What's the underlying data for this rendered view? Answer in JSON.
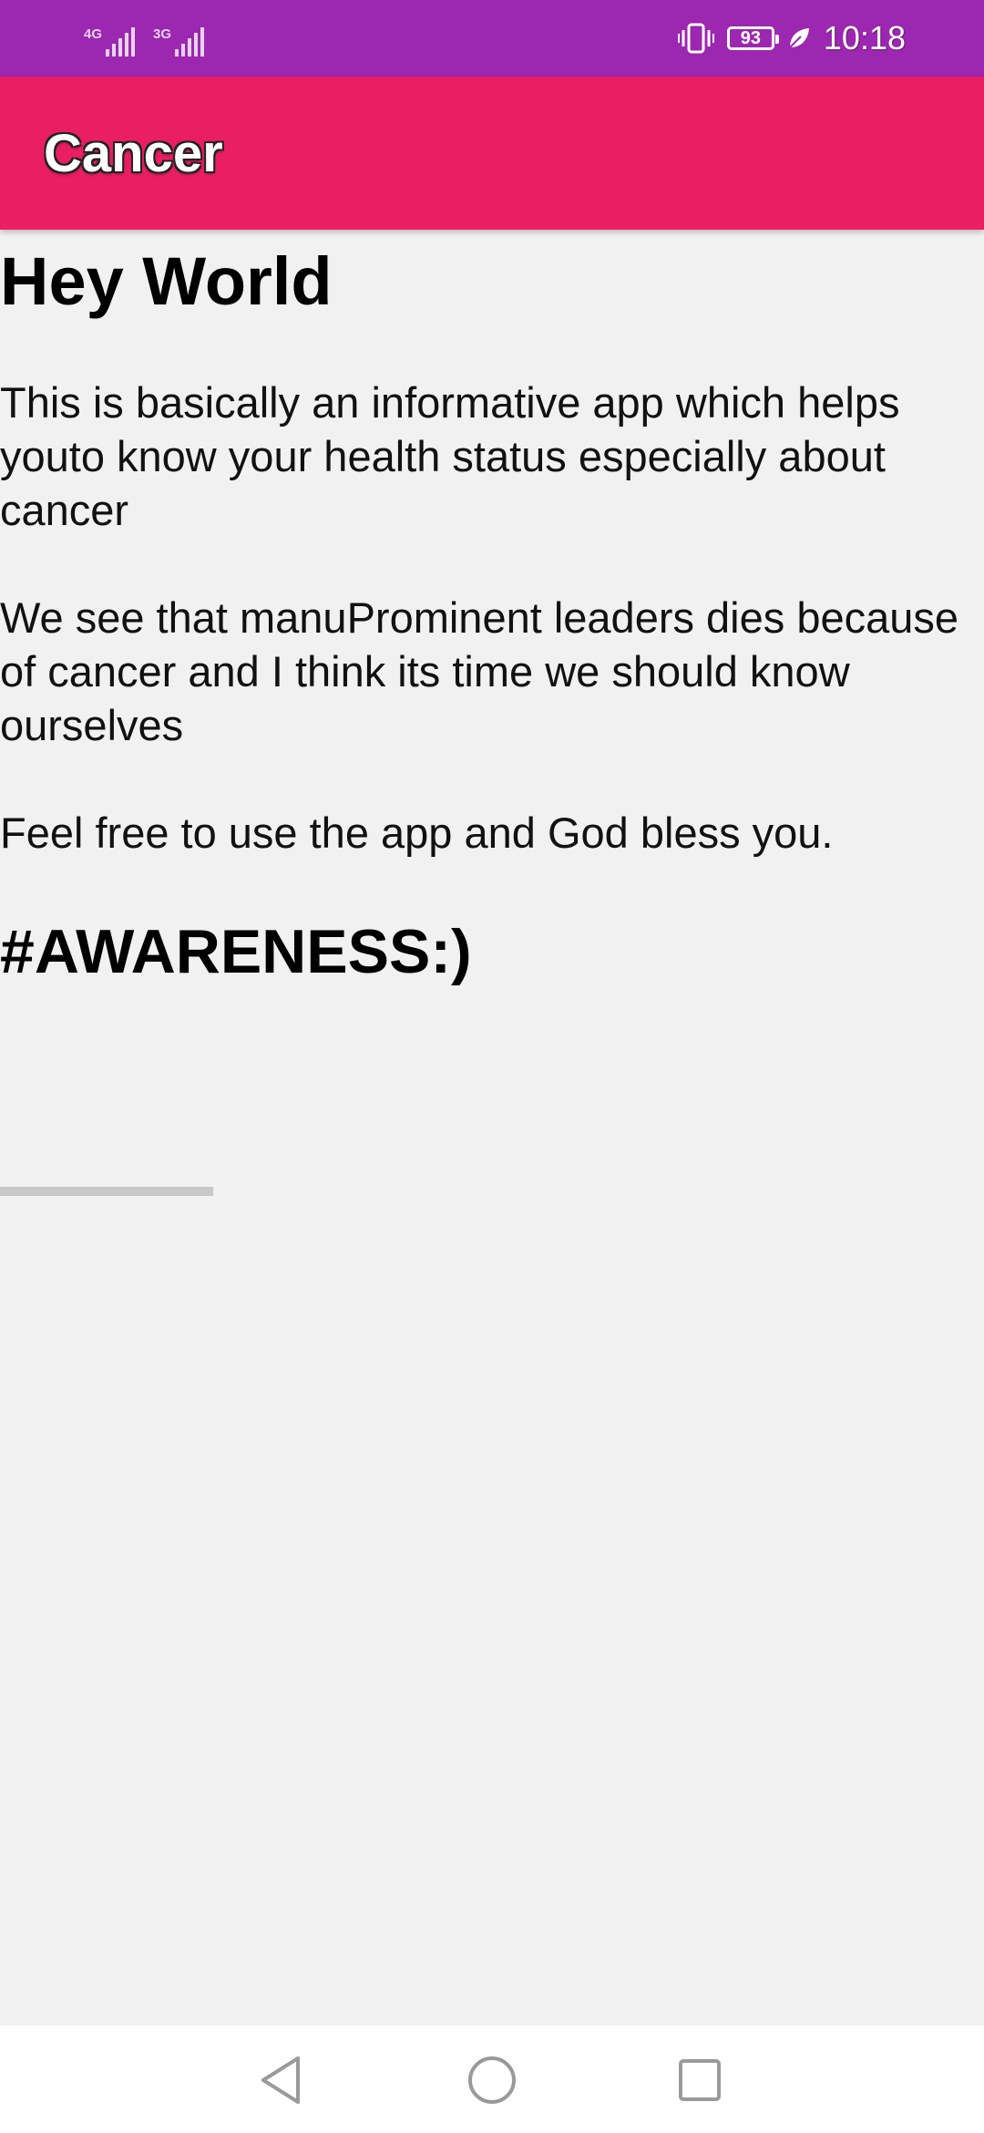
{
  "status_bar": {
    "network_1": "4G",
    "network_2": "3G",
    "battery_level": "93",
    "time": "10:18",
    "icons": [
      "signal-icon",
      "vibrate-icon",
      "battery-icon",
      "power-saver-leaf-icon"
    ]
  },
  "app_bar": {
    "title": "Cancer"
  },
  "content": {
    "heading": "Hey World",
    "paragraphs": [
      "This is basically an informative app which helps youto know your health status especially about cancer",
      "We see that manuProminent leaders dies because of cancer and I think its time we should know ourselves",
      "Feel free to use the app and God bless you."
    ],
    "hashtag": "#AWARENESS:)"
  },
  "nav_bar": {
    "icons": [
      "back-icon",
      "home-icon",
      "recent-apps-icon"
    ]
  },
  "colors": {
    "status_bar": "#9c27b0",
    "app_bar": "#e91e63",
    "background": "#f1f1f1"
  }
}
